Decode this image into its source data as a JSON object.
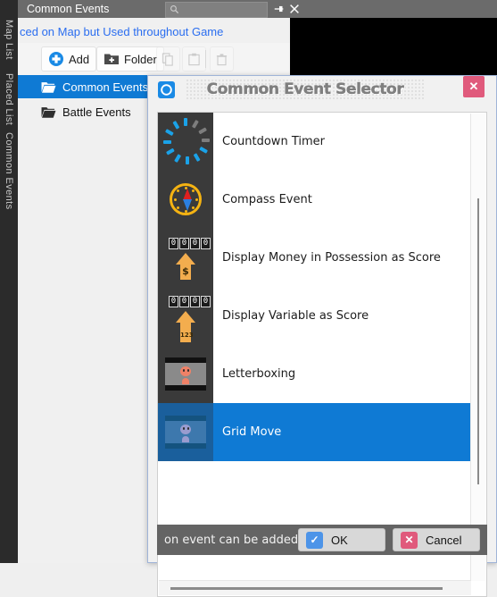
{
  "app": {
    "rail_tabs": [
      {
        "label": "Map List"
      },
      {
        "label": "Placed List"
      },
      {
        "label": "Common Events"
      }
    ]
  },
  "panel": {
    "title": "Common Events",
    "search_placeholder": "",
    "search_value": "",
    "search_icon": "search-icon",
    "pin_icon": "pin-icon",
    "close_icon": "close-icon",
    "link_text": "ced on Map but Used throughout Game",
    "toolbar": {
      "add_label": "Add",
      "folder_label": "Folder",
      "copy_icon": "copy-icon",
      "paste_icon": "paste-icon",
      "delete_icon": "trash-icon"
    },
    "tree": [
      {
        "label": "Common Events",
        "icon": "folder-icon",
        "selected": true
      },
      {
        "label": "Battle Events",
        "icon": "folder-icon",
        "selected": false
      }
    ]
  },
  "dialog": {
    "app_icon": "gear-icon",
    "title": "Common Event Selector",
    "close_label": "✕",
    "close_icon": "close-icon",
    "events": [
      {
        "label": "Countdown Timer",
        "icon": "countdown-timer-icon",
        "selected": false
      },
      {
        "label": "Compass Event",
        "icon": "compass-icon",
        "selected": false
      },
      {
        "label": "Display Money in Possession as Score",
        "icon": "money-score-icon",
        "selected": false
      },
      {
        "label": "Display Variable as Score",
        "icon": "variable-score-icon",
        "selected": false
      },
      {
        "label": "Letterboxing",
        "icon": "letterbox-icon",
        "selected": false
      },
      {
        "label": "Grid Move",
        "icon": "grid-move-icon",
        "selected": true
      }
    ],
    "footer": {
      "note": "on event can be added tha",
      "ok_label": "OK",
      "ok_icon": "check-icon",
      "cancel_label": "Cancel",
      "cancel_icon": "cross-icon"
    }
  },
  "colors": {
    "accent_blue": "#0f7ad4",
    "pink": "#e05a7c",
    "orange": "#f3ad4e",
    "gold": "#f5b312",
    "grey_titlebar": "#6b6b6b",
    "footer_grey": "#646464"
  }
}
